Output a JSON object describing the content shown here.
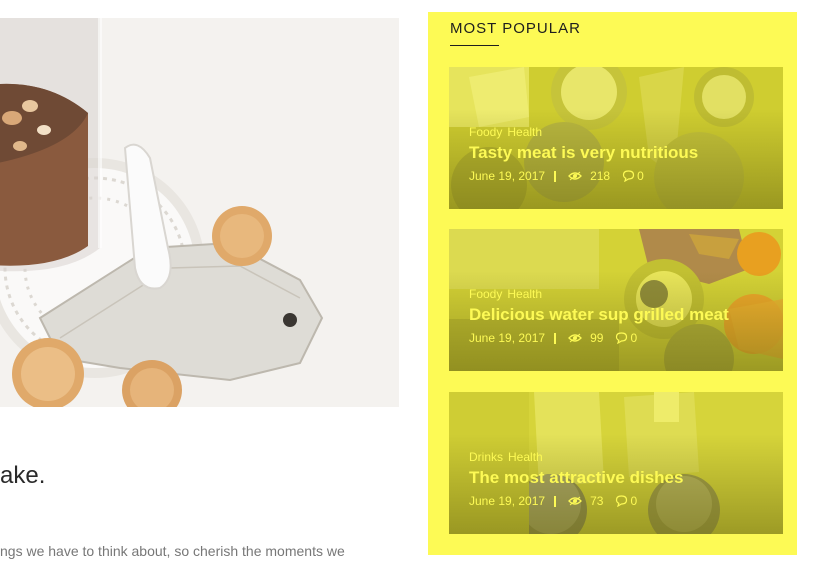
{
  "article": {
    "title": "ake.",
    "excerpt": "ngs we have to think about, so cherish the moments we"
  },
  "widget": {
    "title": "MOST POPULAR",
    "accent_color": "#fdfa55",
    "posts": [
      {
        "categories": [
          "Foody",
          "Health"
        ],
        "title": "Tasty meat is very nutritious",
        "date": "June 19, 2017",
        "views": "218",
        "comments": "0"
      },
      {
        "categories": [
          "Foody",
          "Health"
        ],
        "title": "Delicious water sup grilled meat",
        "date": "June 19, 2017",
        "views": "99",
        "comments": "0"
      },
      {
        "categories": [
          "Drinks",
          "Health"
        ],
        "title": "The most attractive dishes",
        "date": "June 19, 2017",
        "views": "73",
        "comments": "0"
      }
    ]
  },
  "icons": {
    "views": "eye-icon",
    "comments": "comment-icon"
  }
}
